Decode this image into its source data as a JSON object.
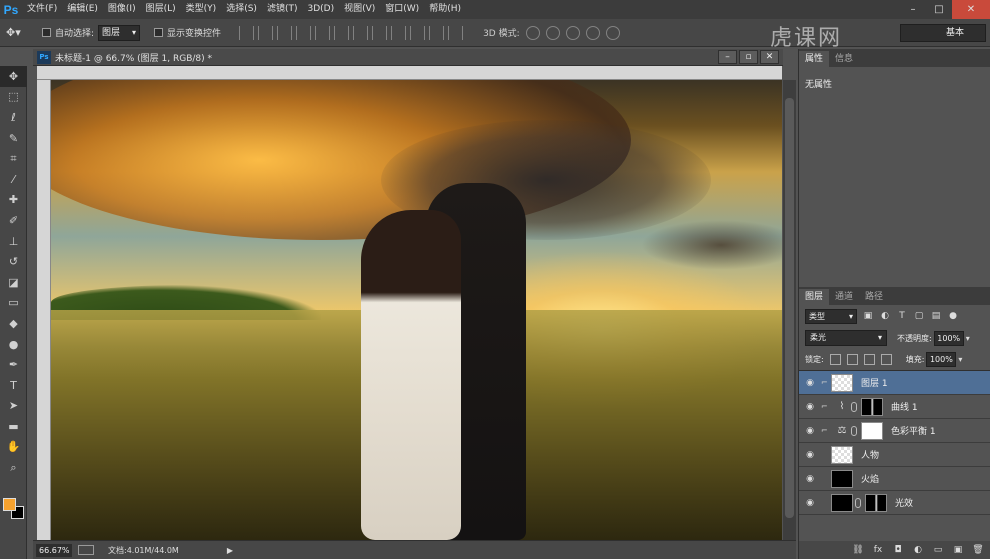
{
  "menubar": {
    "logo": "Ps",
    "items": [
      "文件(F)",
      "编辑(E)",
      "图像(I)",
      "图层(L)",
      "类型(Y)",
      "选择(S)",
      "滤镜(T)",
      "3D(D)",
      "视图(V)",
      "窗口(W)",
      "帮助(H)"
    ]
  },
  "options": {
    "auto_select_label": "自动选择:",
    "auto_select_value": "图层",
    "show_transform_label": "显示变换控件",
    "mode3d_label": "3D 模式:",
    "workspace": "基本"
  },
  "document": {
    "tab_title": "未标题-1 @ 66.7% (图层 1, RGB/8) *"
  },
  "status": {
    "zoom": "66.67%",
    "doc_info": "文档:4.01M/44.0M"
  },
  "properties": {
    "tabs": [
      "属性",
      "信息"
    ],
    "content": "无属性"
  },
  "layers_panel": {
    "tabs": [
      "图层",
      "通道",
      "路径"
    ],
    "kind": "类型",
    "blend_mode": "柔光",
    "opacity_label": "不透明度:",
    "opacity": "100%",
    "lock_label": "锁定:",
    "fill_label": "填充:",
    "fill": "100%",
    "layers": [
      {
        "name": "图层 1",
        "selected": true
      },
      {
        "name": "曲线 1",
        "selected": false
      },
      {
        "name": "色彩平衡 1",
        "selected": false
      },
      {
        "name": "人物",
        "selected": false
      },
      {
        "name": "火焰",
        "selected": false
      },
      {
        "name": "光效",
        "selected": false
      }
    ]
  },
  "watermark": "虎课网",
  "colors": {
    "foreground": "#f6a22e",
    "background": "#000000",
    "selection": "#4f6f96"
  }
}
